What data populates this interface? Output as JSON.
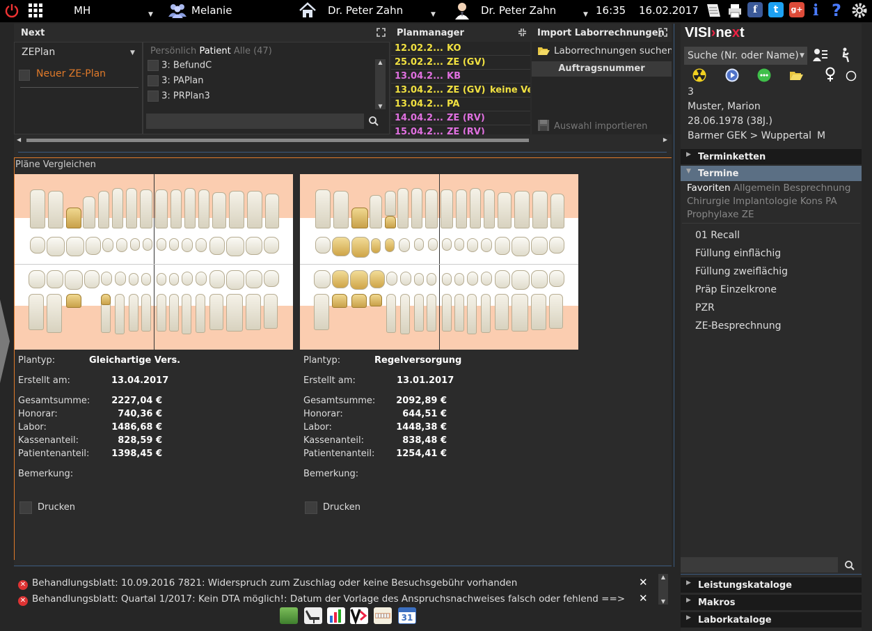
{
  "topbar": {
    "user_short": "MH",
    "user_name": "Melanie",
    "doctor1": "Dr. Peter Zahn",
    "doctor2": "Dr. Peter Zahn",
    "time": "16:35",
    "date": "16.02.2017"
  },
  "next": {
    "title": "Next",
    "select": "ZEPlan",
    "new_item": "Neuer ZE-Plan",
    "tabs": [
      "Persönlich",
      "Patient",
      "Alle (47)"
    ],
    "items": [
      "3: BefundC",
      "3: PAPlan",
      "3: PRPlan3"
    ]
  },
  "planmanager": {
    "title": "Planmanager",
    "rows": [
      {
        "date": "12.02.2...",
        "type": "KO",
        "extra": "",
        "color": "#f0e040"
      },
      {
        "date": "25.02.2...",
        "type": "ZE (GV)",
        "extra": "",
        "color": "#f0e040"
      },
      {
        "date": "13.04.2...",
        "type": "KB",
        "extra": "",
        "color": "#e070e0"
      },
      {
        "date": "13.04.2...",
        "type": "ZE (GV)",
        "extra": "keine Vers",
        "color": "#f0e040"
      },
      {
        "date": "13.04.2...",
        "type": "PA",
        "extra": "",
        "color": "#f0e040"
      },
      {
        "date": "14.04.2...",
        "type": "ZE (RV)",
        "extra": "",
        "color": "#e070e0"
      },
      {
        "date": "15.04.2...",
        "type": "ZE (RV)",
        "extra": "",
        "color": "#e070e0"
      }
    ]
  },
  "import": {
    "title": "Import Laborrechnungen",
    "search": "Laborrechnungen suchen ...",
    "column": "Auftragsnummer",
    "import_btn": "Auswahl importieren"
  },
  "compare": {
    "title": "Pläne Vergleichen",
    "left": {
      "plantyp_label": "Plantyp:",
      "plantyp": "Gleichartige Vers.",
      "erstellt_label": "Erstellt am:",
      "erstellt": "13.04.2017",
      "gesamt_label": "Gesamtsumme:",
      "gesamt": "2227,04 €",
      "honorar_label": "Honorar:",
      "honorar": "740,36 €",
      "labor_label": "Labor:",
      "labor": "1486,68 €",
      "kassen_label": "Kassenanteil:",
      "kassen": "828,59 €",
      "patient_label": "Patientenanteil:",
      "patient": "1398,45 €",
      "bemerkung_label": "Bemerkung:",
      "drucken": "Drucken"
    },
    "right": {
      "plantyp_label": "Plantyp:",
      "plantyp": "Regelversorgung",
      "erstellt_label": "Erstellt am:",
      "erstellt": "13.01.2017",
      "gesamt_label": "Gesamtsumme:",
      "gesamt": "2092,89 €",
      "honorar_label": "Honorar:",
      "honorar": "644,51 €",
      "labor_label": "Labor:",
      "labor": "1448,38 €",
      "kassen_label": "Kassenanteil:",
      "kassen": "838,48 €",
      "patient_label": "Patientenanteil:",
      "patient": "1254,41 €",
      "bemerkung_label": "Bemerkung:",
      "drucken": "Drucken"
    }
  },
  "patient": {
    "logo_a": "VISI",
    "logo_b": "ne",
    "logo_c": "x",
    "logo_d": "t",
    "search": "Suche (Nr. oder Name)",
    "number": "3",
    "name": "Muster, Marion",
    "dob": "28.06.1978 (38J.)",
    "insurance": "Barmer GEK > Wuppertal",
    "gender": "M"
  },
  "sidebar": {
    "terminketten": "Terminketten",
    "termine": "Termine",
    "tags_active": "Favoriten",
    "tags_line1": "Allgemein Besprechnung",
    "tags_line2": "Chirurgie Implantologie Kons PA",
    "tags_line3": "Prophylaxe ZE",
    "items": [
      "01 Recall",
      "Füllung einflächig",
      "Füllung zweiflächig",
      "Präp Einzelkrone",
      "PZR",
      "ZE-Besprechnung"
    ],
    "leistungskataloge": "Leistungskataloge",
    "makros": "Makros",
    "laborkataloge": "Laborkataloge"
  },
  "messages": [
    "Behandlungsblatt: 10.09.2016 7821: Widerspruch zum Zuschlag oder keine Besuchsgebühr vorhanden",
    "Behandlungsblatt: Quartal 1/2017: Kein DTA möglich!: Datum der Vorlage des Anspruchsnachweises falsch oder fehlend ==>"
  ],
  "colors": {
    "accent": "#e07a2a",
    "planmanager_yellow": "#f0e040",
    "planmanager_pink": "#e070e0",
    "tooth_bg": "#fbcdb0",
    "gold": "#d8b058"
  }
}
